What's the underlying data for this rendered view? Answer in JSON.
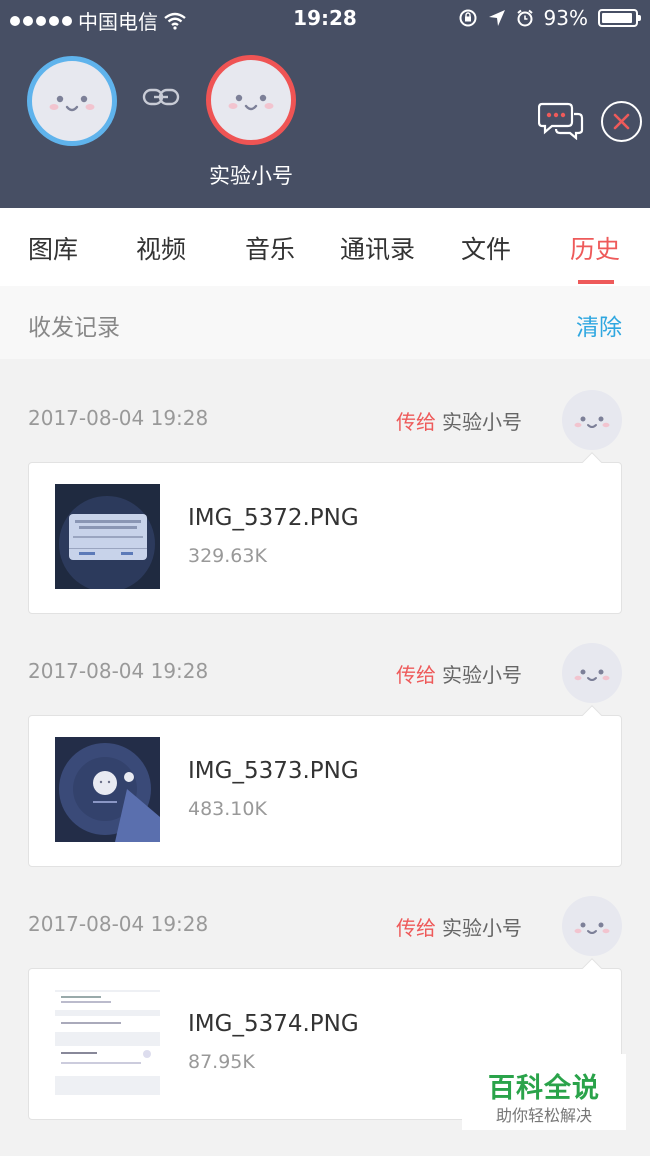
{
  "status_bar": {
    "carrier": "中国电信",
    "time": "19:28",
    "battery": "93%",
    "battery_level": 0.93
  },
  "header": {
    "peer_name": "实验小号",
    "icons": [
      "link-icon",
      "chat-icon",
      "close-icon"
    ]
  },
  "tabs": [
    {
      "label": "图库"
    },
    {
      "label": "视频"
    },
    {
      "label": "音乐"
    },
    {
      "label": "通讯录"
    },
    {
      "label": "文件"
    },
    {
      "label": "历史",
      "active": true
    }
  ],
  "section": {
    "title": "收发记录",
    "clear_label": "清除"
  },
  "records": [
    {
      "date": "2017-08-04 19:28",
      "verb": "传给",
      "recipient": "实验小号",
      "file_name": "IMG_5372.PNG",
      "file_size": "329.63K"
    },
    {
      "date": "2017-08-04 19:28",
      "verb": "传给",
      "recipient": "实验小号",
      "file_name": "IMG_5373.PNG",
      "file_size": "483.10K"
    },
    {
      "date": "2017-08-04 19:28",
      "verb": "传给",
      "recipient": "实验小号",
      "file_name": "IMG_5374.PNG",
      "file_size": "87.95K"
    }
  ],
  "watermark": {
    "title": "百科全说",
    "subtitle": "助你轻松解决"
  },
  "colors": {
    "header_bg": "#474f64",
    "accent_red": "#ee5a5a",
    "accent_blue": "#2fa7e0",
    "self_ring": "#5fb3ec",
    "peer_ring": "#ef5454"
  }
}
